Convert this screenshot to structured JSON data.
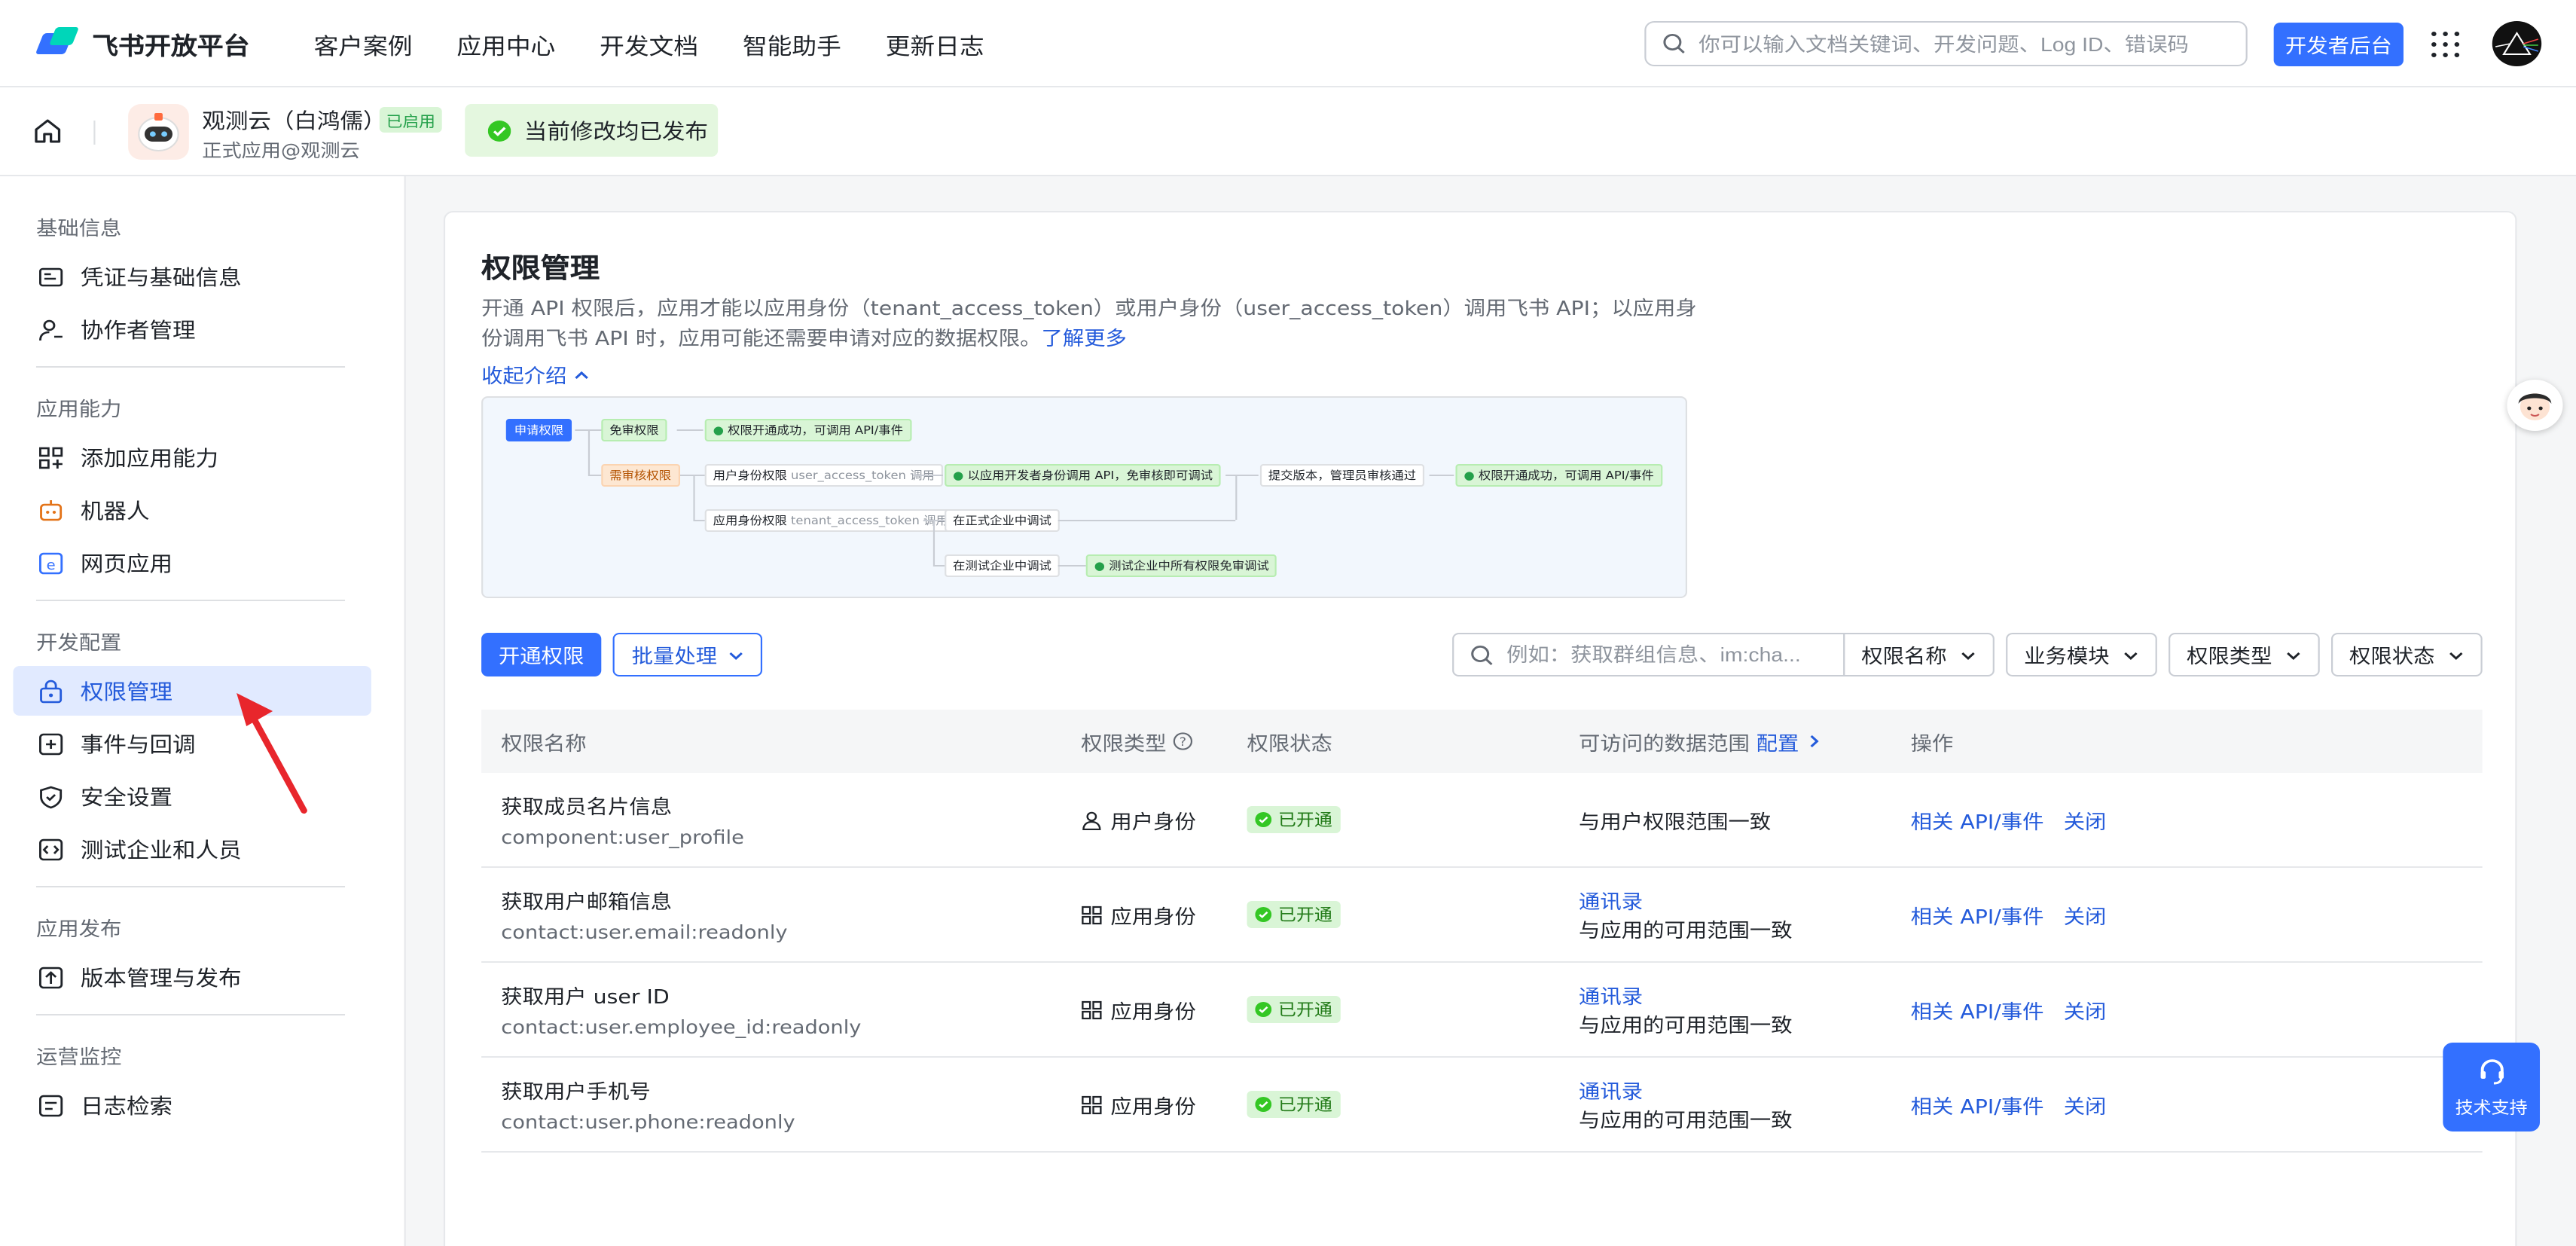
{
  "nav": {
    "logo_text": "飞书开放平台",
    "links": [
      "客户案例",
      "应用中心",
      "开发文档",
      "智能助手",
      "更新日志"
    ],
    "search_placeholder": "你可以输入文档关键词、开发问题、Log ID、错误码",
    "dev_button": "开发者后台"
  },
  "app": {
    "name": "观测云（白鸿儒）",
    "status": "已启用",
    "subtitle": "正式应用@观测云",
    "published_message": "当前修改均已发布"
  },
  "sidebar": {
    "groups": [
      {
        "title": "基础信息",
        "items": [
          {
            "label": "凭证与基础信息",
            "icon": "id-card-icon"
          },
          {
            "label": "协作者管理",
            "icon": "user-add-icon"
          }
        ]
      },
      {
        "title": "应用能力",
        "items": [
          {
            "label": "添加应用能力",
            "icon": "grid-add-icon"
          },
          {
            "label": "机器人",
            "icon": "robot-icon"
          },
          {
            "label": "网页应用",
            "icon": "web-icon"
          }
        ]
      },
      {
        "title": "开发配置",
        "items": [
          {
            "label": "权限管理",
            "icon": "lock-icon"
          },
          {
            "label": "事件与回调",
            "icon": "event-icon"
          },
          {
            "label": "安全设置",
            "icon": "shield-icon"
          },
          {
            "label": "测试企业和人员",
            "icon": "code-icon"
          }
        ]
      },
      {
        "title": "应用发布",
        "items": [
          {
            "label": "版本管理与发布",
            "icon": "upload-icon"
          }
        ]
      },
      {
        "title": "运营监控",
        "items": [
          {
            "label": "日志检索",
            "icon": "log-icon"
          }
        ]
      }
    ],
    "active": "权限管理"
  },
  "main": {
    "title": "权限管理",
    "description": "开通 API 权限后，应用才能以应用身份（tenant_access_token）或用户身份（user_access_token）调用飞书 API；以应用身份调用飞书 API 时，应用可能还需要申请对应的数据权限。",
    "learn_more": "了解更多",
    "collapse_label": "收起介绍",
    "flow": {
      "apply": "申请权限",
      "no_review": "免审权限",
      "success1": "权限开通成功，可调用 API/事件",
      "need_review": "需审核权限",
      "user_perm": "用户身份权限",
      "user_token": "user_access_token 调用",
      "dev_identity": "以应用开发者身份调用 API，免审核即可调试",
      "submit": "提交版本，管理员审核通过",
      "success2": "权限开通成功，可调用 API/事件",
      "app_perm": "应用身份权限",
      "tenant_token": "tenant_access_token 调用",
      "formal": "在正式企业中调试",
      "test": "在测试企业中调试",
      "test_exempt": "测试企业中所有权限免审调试"
    },
    "open_button": "开通权限",
    "batch_button": "批量处理",
    "filter_placeholder": "例如：获取群组信息、im:cha...",
    "filters": [
      "权限名称",
      "业务模块",
      "权限类型",
      "权限状态"
    ],
    "table": {
      "headers": {
        "name": "权限名称",
        "type": "权限类型",
        "status": "权限状态",
        "scope": "可访问的数据范围",
        "scope_link": "配置",
        "ops": "操作"
      },
      "rows": [
        {
          "name": "获取成员名片信息",
          "key": "component:user_profile",
          "type": "用户身份",
          "type_icon": "user-icon",
          "status": "已开通",
          "scope_link": "",
          "scope": "与用户权限范围一致",
          "op1": "相关 API/事件",
          "op2": "关闭"
        },
        {
          "name": "获取用户邮箱信息",
          "key": "contact:user.email:readonly",
          "type": "应用身份",
          "type_icon": "app-grid-icon",
          "status": "已开通",
          "scope_link": "通讯录",
          "scope": "与应用的可用范围一致",
          "op1": "相关 API/事件",
          "op2": "关闭"
        },
        {
          "name": "获取用户 user ID",
          "key": "contact:user.employee_id:readonly",
          "type": "应用身份",
          "type_icon": "app-grid-icon",
          "status": "已开通",
          "scope_link": "通讯录",
          "scope": "与应用的可用范围一致",
          "op1": "相关 API/事件",
          "op2": "关闭"
        },
        {
          "name": "获取用户手机号",
          "key": "contact:user.phone:readonly",
          "type": "应用身份",
          "type_icon": "app-grid-icon",
          "status": "已开通",
          "scope_link": "通讯录",
          "scope": "与应用的可用范围一致",
          "op1": "相关 API/事件",
          "op2": "关闭"
        }
      ]
    }
  },
  "support": {
    "label": "技术支持"
  },
  "colors": {
    "primary": "#3370ff",
    "success_bg": "#d9f5d6",
    "annotation_arrow": "#e8262c"
  }
}
